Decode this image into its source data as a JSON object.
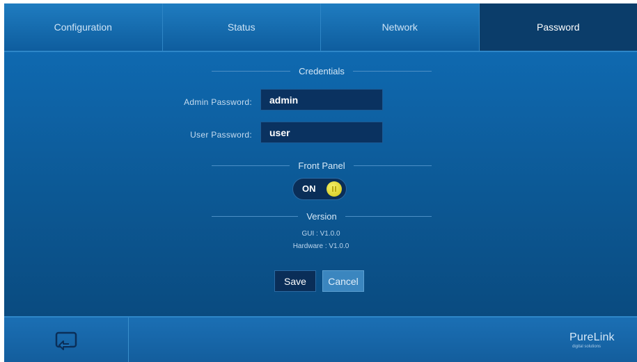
{
  "tabs": [
    {
      "label": "Configuration",
      "active": false
    },
    {
      "label": "Status",
      "active": false
    },
    {
      "label": "Network",
      "active": false
    },
    {
      "label": "Password",
      "active": true
    }
  ],
  "credentials": {
    "title": "Credentials",
    "admin_label": "Admin Password:",
    "admin_value": "admin",
    "user_label": "User Password:",
    "user_value": "user"
  },
  "front_panel": {
    "title": "Front Panel",
    "toggle_label": "ON",
    "state": "on"
  },
  "version": {
    "title": "Version",
    "gui": "GUI : V1.0.0",
    "hardware": "Hardware : V1.0.0"
  },
  "actions": {
    "save_label": "Save",
    "cancel_label": "Cancel"
  },
  "footer": {
    "return_icon": "return-icon",
    "logo_name": "PureLink",
    "logo_sub": "digital solutions"
  },
  "colors": {
    "background": "#0b4f86",
    "active_tab": "#0b3d6a",
    "toggle_knob": "#e6dd2a"
  }
}
